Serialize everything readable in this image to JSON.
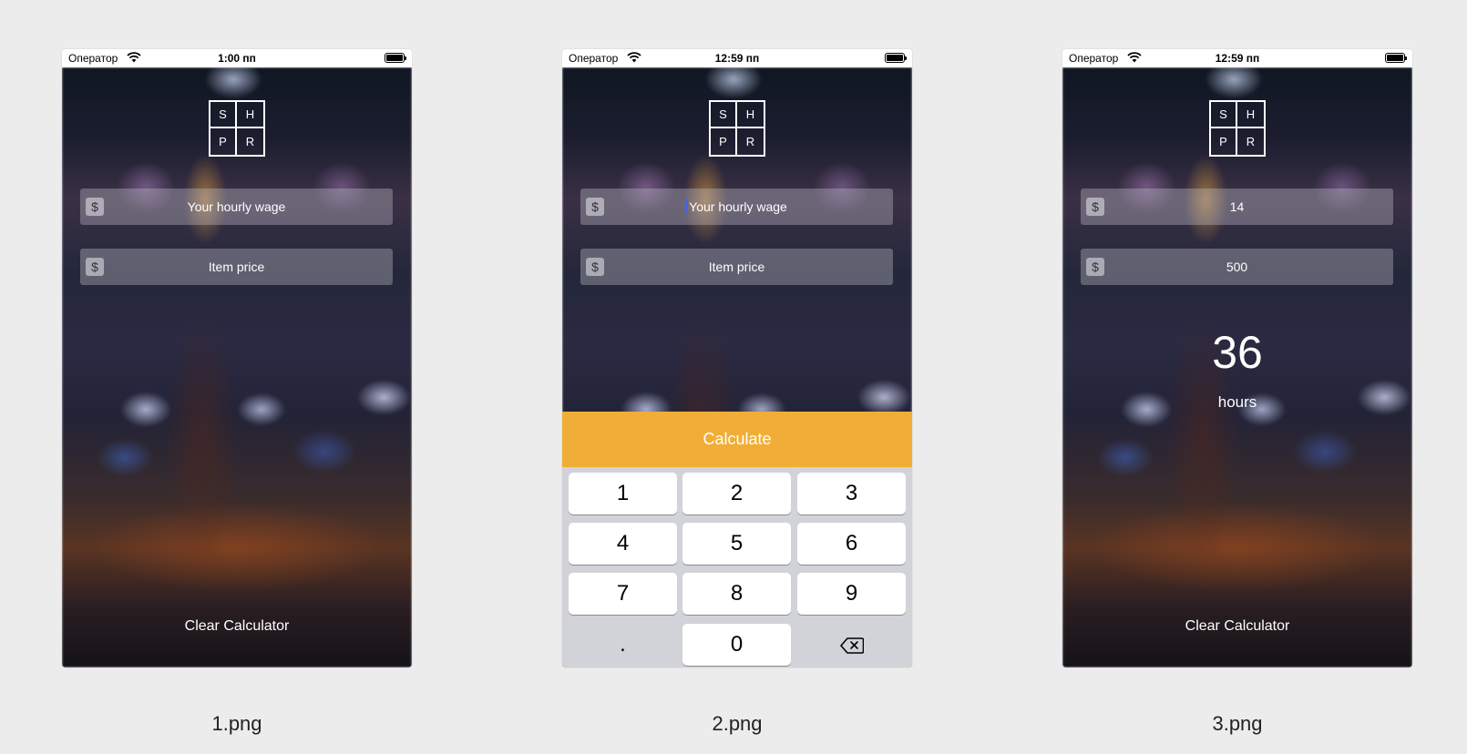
{
  "screens": [
    {
      "status": {
        "carrier": "Оператор",
        "time": "1:00 пп"
      },
      "logo": [
        "S",
        "H",
        "P",
        "R"
      ],
      "wage_field": {
        "icon": "$",
        "text": "Your hourly wage"
      },
      "price_field": {
        "icon": "$",
        "text": "Item price"
      },
      "clear_label": "Clear Calculator",
      "caption": "1.png"
    },
    {
      "status": {
        "carrier": "Оператор",
        "time": "12:59 пп"
      },
      "logo": [
        "S",
        "H",
        "P",
        "R"
      ],
      "wage_field": {
        "icon": "$",
        "text": "Your hourly wage"
      },
      "price_field": {
        "icon": "$",
        "text": "Item price"
      },
      "calculate_label": "Calculate",
      "keypad": [
        "1",
        "2",
        "3",
        "4",
        "5",
        "6",
        "7",
        "8",
        "9",
        ".",
        "0"
      ],
      "caption": "2.png"
    },
    {
      "status": {
        "carrier": "Оператор",
        "time": "12:59 пп"
      },
      "logo": [
        "S",
        "H",
        "P",
        "R"
      ],
      "wage_field": {
        "icon": "$",
        "text": "14"
      },
      "price_field": {
        "icon": "$",
        "text": "500"
      },
      "result": {
        "value": "36",
        "unit": "hours"
      },
      "clear_label": "Clear Calculator",
      "caption": "3.png"
    }
  ]
}
